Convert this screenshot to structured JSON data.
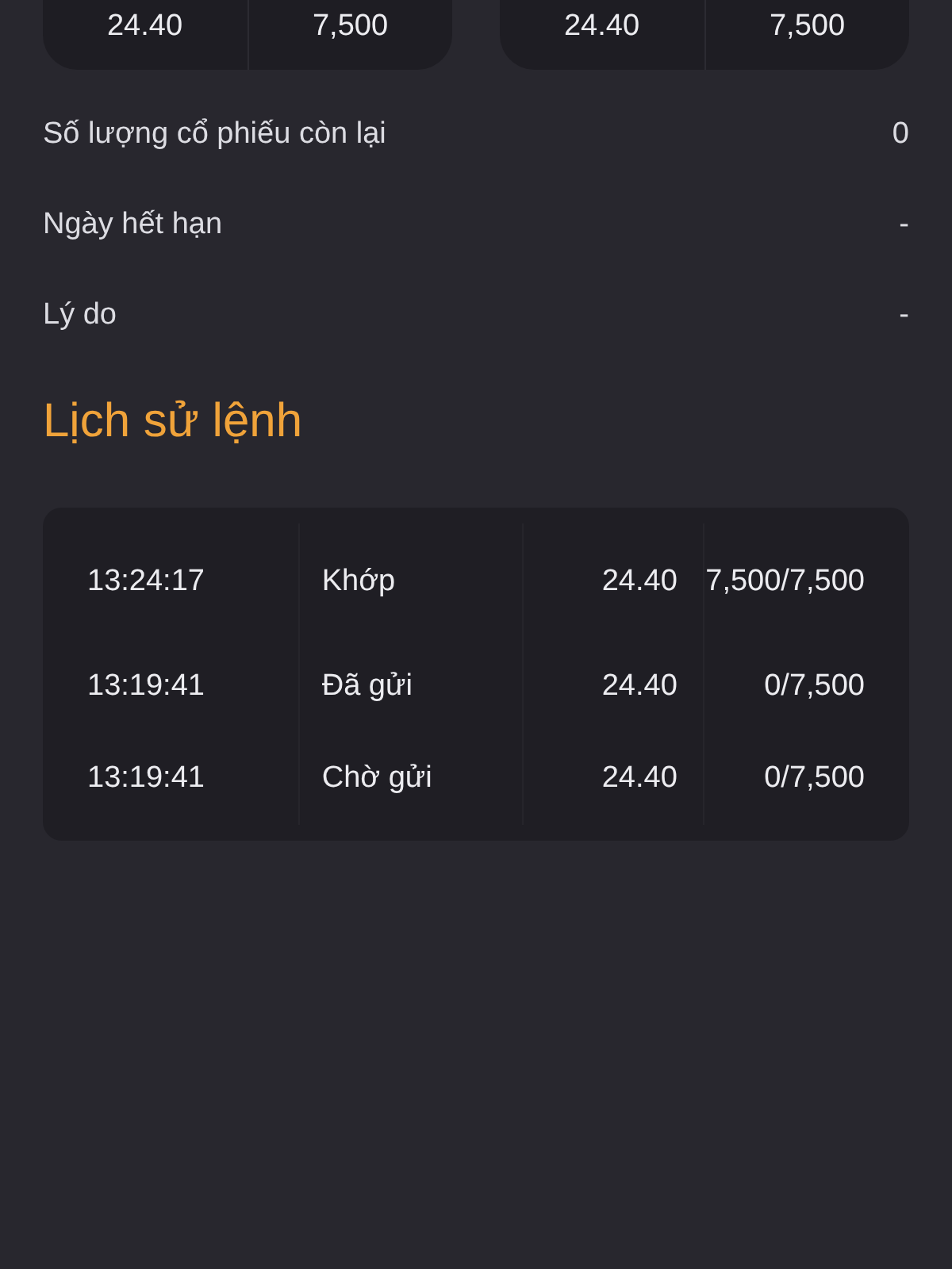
{
  "price_cards": [
    {
      "cells": [
        "24.40",
        "7,500"
      ]
    },
    {
      "cells": [
        "24.40",
        "7,500"
      ]
    }
  ],
  "details": [
    {
      "label": "Số lượng cổ phiếu còn lại",
      "value": "0"
    },
    {
      "label": "Ngày hết hạn",
      "value": "-"
    },
    {
      "label": "Lý do",
      "value": "-"
    }
  ],
  "history": {
    "title": "Lịch sử lệnh",
    "rows": [
      {
        "time": "13:24:17",
        "status": "Khớp",
        "price": "24.40",
        "quantity": "7,500/7,500"
      },
      {
        "time": "13:19:41",
        "status": "Đã gửi",
        "price": "24.40",
        "quantity": "0/7,500"
      },
      {
        "time": "13:19:41",
        "status": "Chờ gửi",
        "price": "24.40",
        "quantity": "0/7,500"
      }
    ]
  }
}
